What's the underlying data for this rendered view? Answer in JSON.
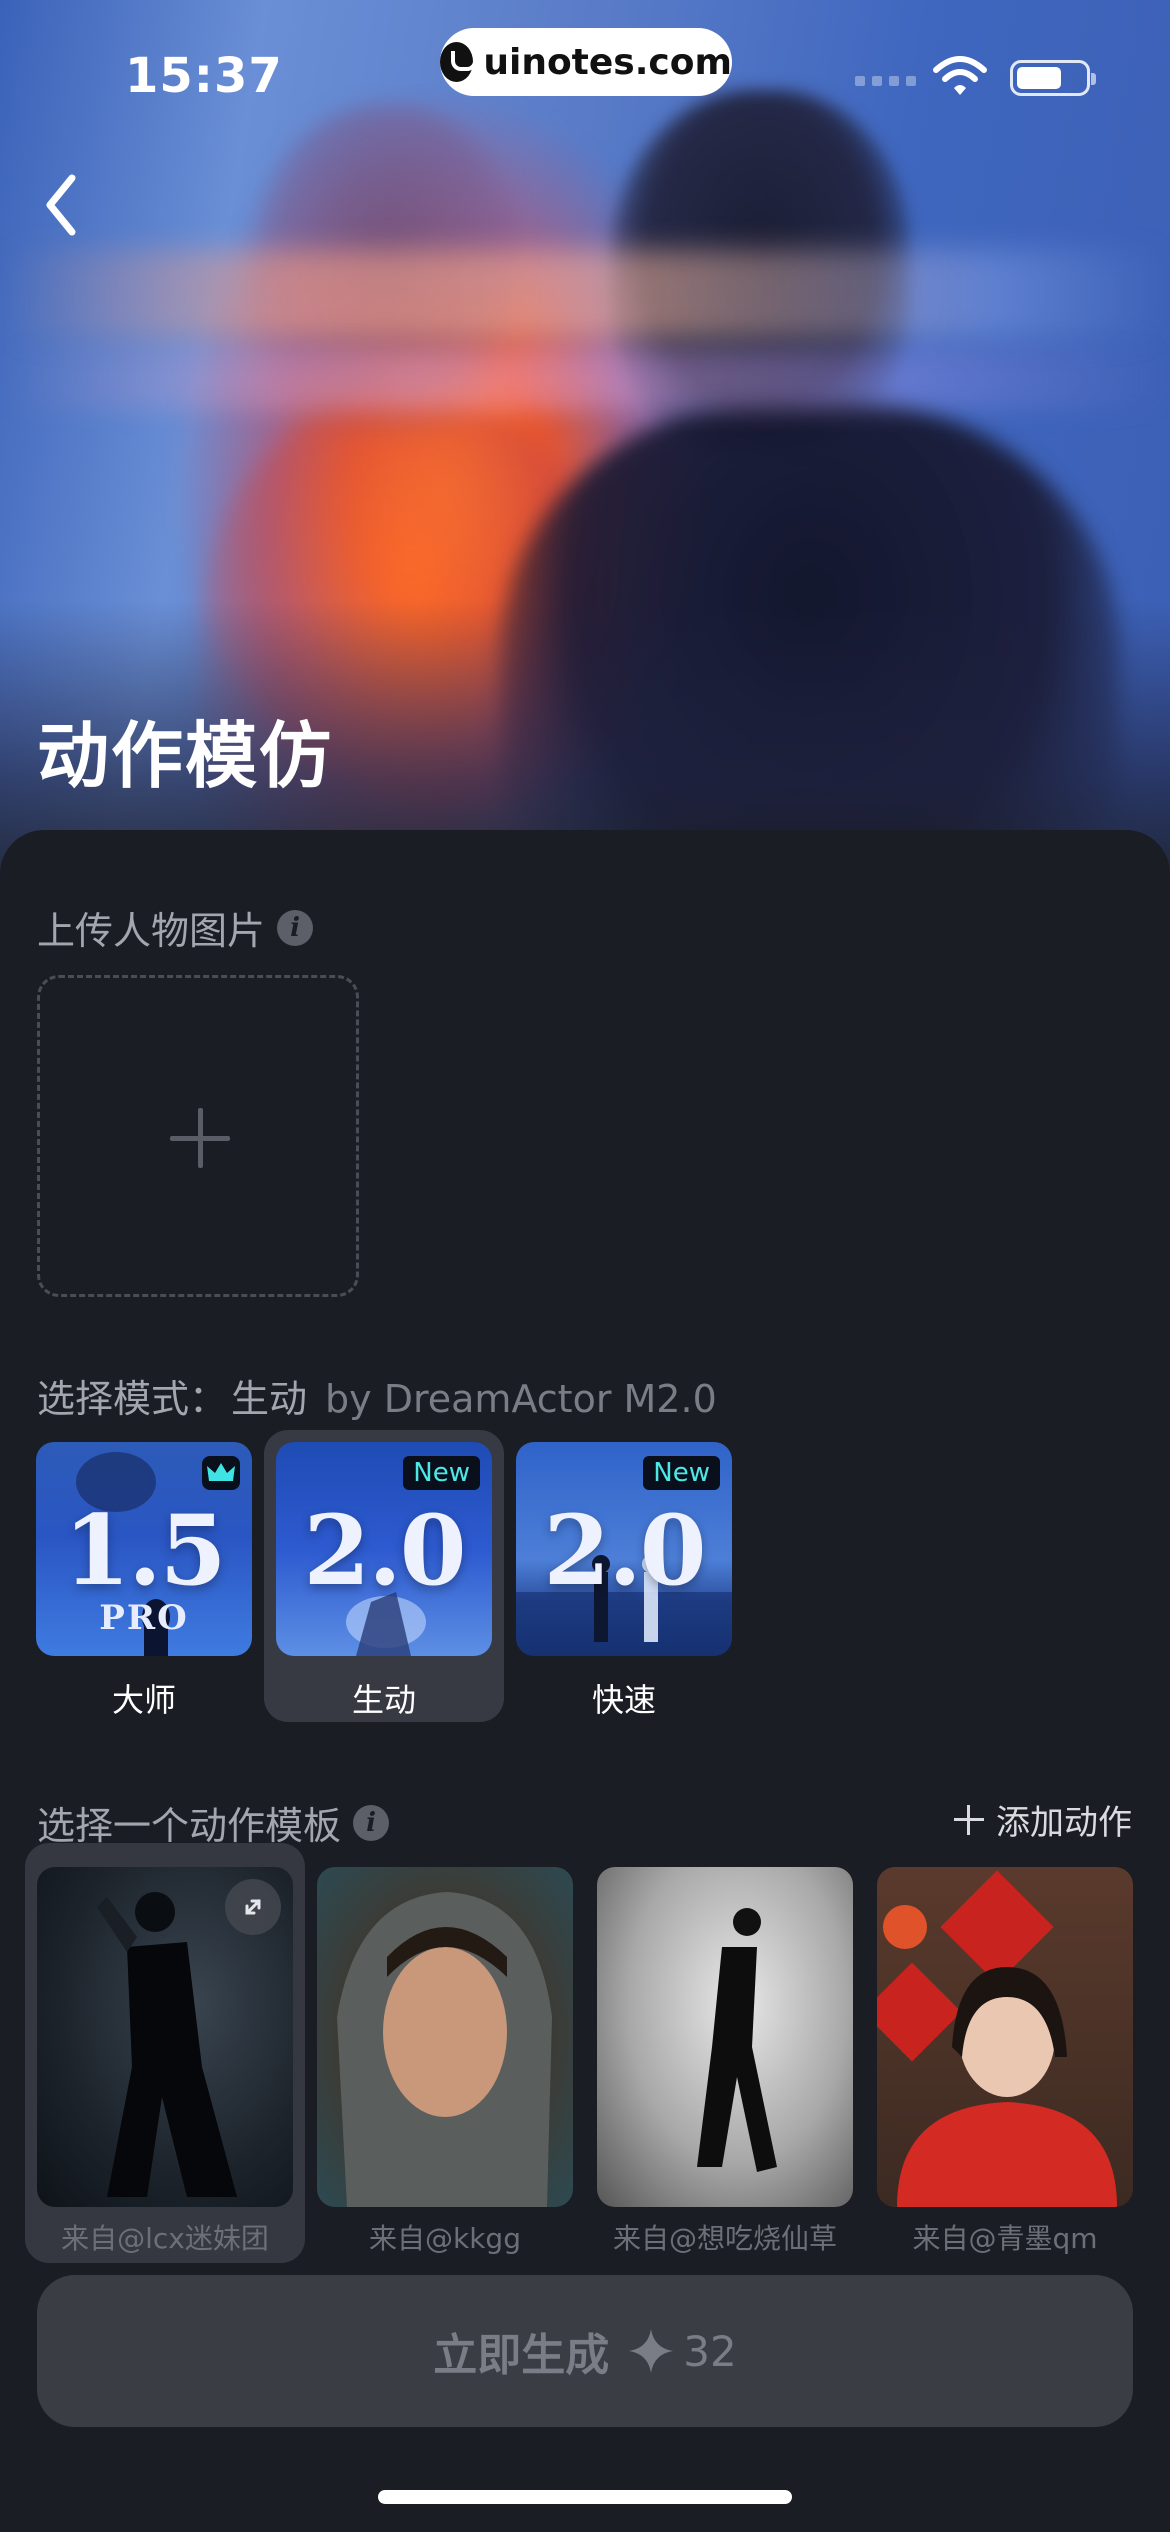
{
  "status_bar": {
    "time": "15:37"
  },
  "watermark": {
    "text": "uinotes.com"
  },
  "header": {
    "title": "动作模仿"
  },
  "upload": {
    "label": "上传人物图片"
  },
  "mode": {
    "heading_prefix": "选择模式：",
    "selected": "生动",
    "model": "by DreamActor M2.0",
    "options": [
      {
        "version": "1.5",
        "sub": "PRO",
        "label": "大师",
        "badge": "crown",
        "selected": false
      },
      {
        "version": "2.0",
        "sub": "",
        "label": "生动",
        "badge": "New",
        "selected": true
      },
      {
        "version": "2.0",
        "sub": "",
        "label": "快速",
        "badge": "New",
        "selected": false
      }
    ]
  },
  "templates": {
    "heading": "选择一个动作模板",
    "add_label": "添加动作",
    "items": [
      {
        "caption": "来自@lcx迷妹团",
        "selected": true
      },
      {
        "caption": "来自@kkgg",
        "selected": false
      },
      {
        "caption": "来自@想吃烧仙草",
        "selected": false
      },
      {
        "caption": "来自@青墨qm",
        "selected": false
      }
    ]
  },
  "generate": {
    "label": "立即生成",
    "cost": "32"
  },
  "colors": {
    "background": "#1b1d24",
    "accent_new": "#4fe6e6",
    "button_bg": "#3b3d45"
  }
}
